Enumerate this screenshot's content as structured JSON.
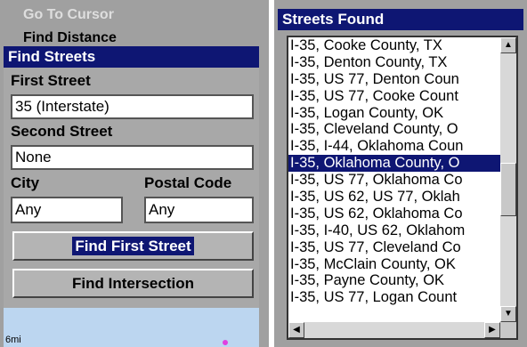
{
  "left_panel": {
    "menu": [
      "Go To Cursor",
      "Find Distance"
    ],
    "title": "Find Streets",
    "first_street_label": "First Street",
    "first_street_value": "35 (Interstate)",
    "second_street_label": "Second Street",
    "second_street_value": "None",
    "city_label": "City",
    "city_value": "Any",
    "postal_label": "Postal Code",
    "postal_value": "Any",
    "find_first_button": "Find First Street",
    "find_intersection_button": "Find Intersection",
    "map_scale": "6mi"
  },
  "right_panel": {
    "title": "Streets Found",
    "selected_index": 7,
    "items": [
      "I-35, Cooke County, TX",
      "I-35, Denton County, TX",
      "I-35, US 77, Denton Coun",
      "I-35, US 77, Cooke Count",
      "I-35, Logan County, OK",
      "I-35, Cleveland County, O",
      "I-35, I-44, Oklahoma Coun",
      "I-35, Oklahoma County, O",
      "I-35, US 77, Oklahoma Co",
      "I-35, US 62, US 77, Oklah",
      "I-35, US 62, Oklahoma Co",
      "I-35, I-40, US 62, Oklahom",
      "I-35, US 77, Cleveland Co",
      "I-35, McClain County, OK",
      "I-35, Payne County, OK",
      "I-35, US 77, Logan Count"
    ],
    "scroll_position_fraction": 0.55
  }
}
